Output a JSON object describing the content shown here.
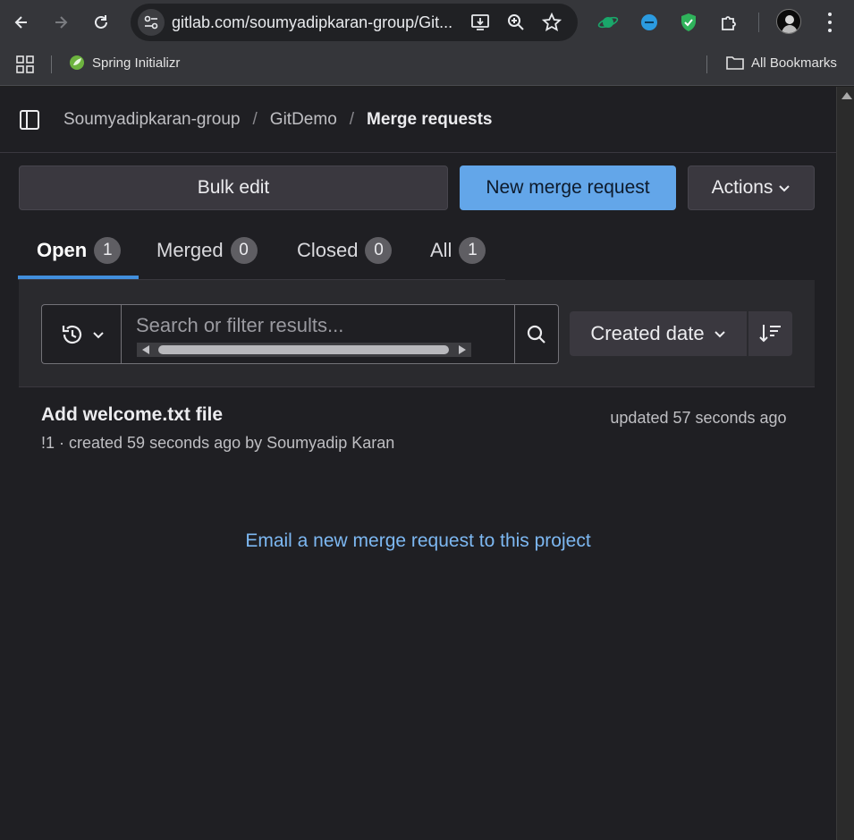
{
  "browser": {
    "url": "gitlab.com/soumyadipkaran-group/Git...",
    "bookmarks": {
      "items": [
        {
          "label": "Spring Initializr"
        }
      ],
      "all_bookmarks_label": "All Bookmarks"
    }
  },
  "breadcrumb": {
    "items": [
      "Soumyadipkaran-group",
      "GitDemo",
      "Merge requests"
    ],
    "separator": "/"
  },
  "actions_bar": {
    "bulk_edit_label": "Bulk edit",
    "new_mr_label": "New merge request",
    "actions_label": "Actions"
  },
  "tabs": [
    {
      "label": "Open",
      "count": "1",
      "active": true
    },
    {
      "label": "Merged",
      "count": "0"
    },
    {
      "label": "Closed",
      "count": "0"
    },
    {
      "label": "All",
      "count": "1"
    }
  ],
  "filter": {
    "search_placeholder": "Search or filter results...",
    "sort_label": "Created date"
  },
  "merge_requests": [
    {
      "title": "Add welcome.txt file",
      "meta": "!1 · created 59 seconds ago by Soumyadip Karan",
      "updated": "updated 57 seconds ago"
    }
  ],
  "email_link_label": "Email a new merge request to this project",
  "colors": {
    "accent": "#63a6e9",
    "link": "#7db8f2",
    "active_tab_indicator": "#428fdc"
  }
}
